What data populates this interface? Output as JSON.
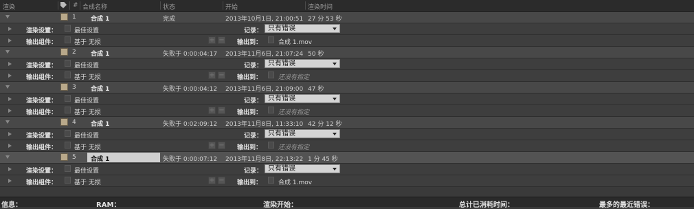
{
  "header": {
    "col_render": "渲染",
    "col_num": "#",
    "col_comp": "合成名称",
    "col_status": "状态",
    "col_start": "开始",
    "col_time": "渲染时间"
  },
  "labels": {
    "render_settings": "渲染设置：",
    "output_module": "输出组件：",
    "log": "记录：",
    "output_to": "输出到："
  },
  "items": [
    {
      "num": "1",
      "comp": "合成 1",
      "status": "完成",
      "start": "2013年10月1日, 21:00:51",
      "time": "27 分 53 秒",
      "render_settings": "最佳设置",
      "output_module": "基于 无损",
      "log": "只有错误",
      "output_to": "合成 1.mov",
      "output_italic": false
    },
    {
      "num": "2",
      "comp": "合成 1",
      "status": "失败于 0:00:04:17",
      "start": "2013年11月6日, 21:07:24",
      "time": "50 秒",
      "render_settings": "最佳设置",
      "output_module": "基于 无损",
      "log": "只有错误",
      "output_to": "还没有指定",
      "output_italic": true
    },
    {
      "num": "3",
      "comp": "合成 1",
      "status": "失败于 0:00:04:12",
      "start": "2013年11月6日, 21:09:00",
      "time": "47 秒",
      "render_settings": "最佳设置",
      "output_module": "基于 无损",
      "log": "只有错误",
      "output_to": "还没有指定",
      "output_italic": true
    },
    {
      "num": "4",
      "comp": "合成 1",
      "status": "失败于 0:02:09:12",
      "start": "2013年11月8日, 11:33:10",
      "time": "42 分 12 秒",
      "render_settings": "最佳设置",
      "output_module": "基于 无损",
      "log": "只有错误",
      "output_to": "还没有指定",
      "output_italic": true
    },
    {
      "num": "5",
      "comp": "合成 1",
      "status": "失败于 0:00:07:12",
      "start": "2013年11月8日, 22:13:22",
      "time": "1 分 45 秒",
      "render_settings": "最佳设置",
      "output_module": "基于 无损",
      "log": "只有错误",
      "output_to": "合成 1.mov",
      "output_italic": false
    }
  ],
  "footer": {
    "info": "信息：",
    "ram": "RAM：",
    "render_start": "渲染开始：",
    "total_elapsed": "总计已消耗时间：",
    "recent_errors": "最多的最近错误："
  },
  "colors": {
    "swatch": "#b8a88a",
    "selected_row": "#535353"
  }
}
